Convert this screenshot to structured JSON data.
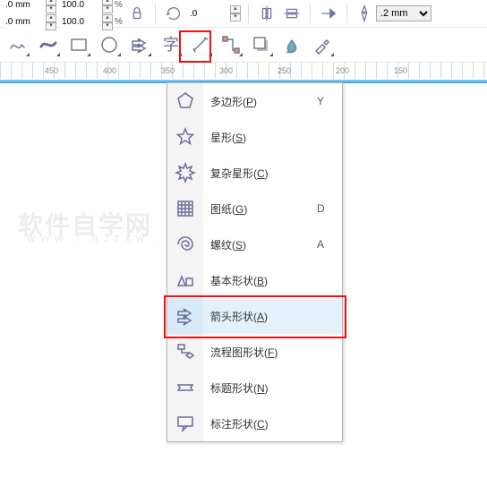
{
  "propbar": {
    "xpos": ".0 mm",
    "ypos": ".0 mm",
    "wscale": "100.0",
    "hscale": "100.0",
    "scale_unit": "%",
    "rotation": ".0",
    "outline_width": ".2 mm"
  },
  "ruler": {
    "ticks": [
      "450",
      "400",
      "350",
      "300",
      "250",
      "200",
      "150"
    ]
  },
  "flyout": {
    "items": [
      {
        "label_pre": "多边形(",
        "hotkey": "P",
        "label_post": ")",
        "shortcut": "Y"
      },
      {
        "label_pre": "星形(",
        "hotkey": "S",
        "label_post": ")",
        "shortcut": ""
      },
      {
        "label_pre": "复杂星形(",
        "hotkey": "C",
        "label_post": ")",
        "shortcut": ""
      },
      {
        "label_pre": "图纸(",
        "hotkey": "G",
        "label_post": ")",
        "shortcut": "D"
      },
      {
        "label_pre": "螺纹(",
        "hotkey": "S",
        "label_post": ")",
        "shortcut": "A"
      },
      {
        "label_pre": "基本形状(",
        "hotkey": "B",
        "label_post": ")",
        "shortcut": ""
      },
      {
        "label_pre": "箭头形状(",
        "hotkey": "A",
        "label_post": ")",
        "shortcut": ""
      },
      {
        "label_pre": "流程图形状(",
        "hotkey": "F",
        "label_post": ")",
        "shortcut": ""
      },
      {
        "label_pre": "标题形状(",
        "hotkey": "N",
        "label_post": ")",
        "shortcut": ""
      },
      {
        "label_pre": "标注形状(",
        "hotkey": "C",
        "label_post": ")",
        "shortcut": ""
      }
    ],
    "highlight_index": 6
  },
  "watermark": {
    "line1": "软件自学网",
    "line2": "WWW . RJZXW . COM"
  }
}
